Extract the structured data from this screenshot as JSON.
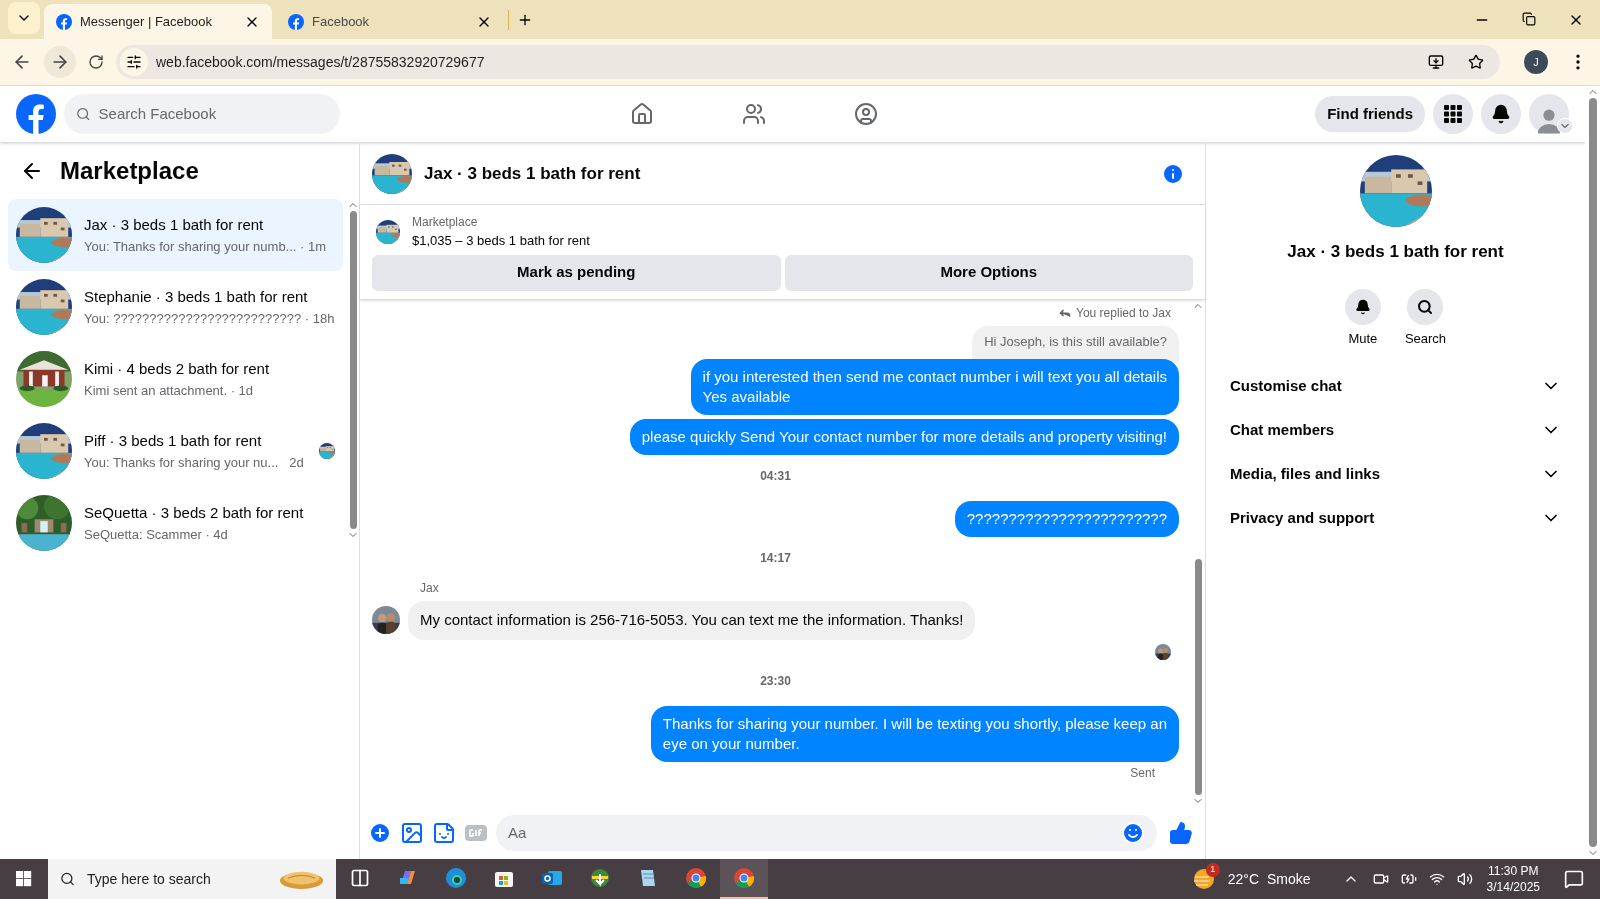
{
  "browser": {
    "tabs": [
      {
        "title": "Messenger | Facebook",
        "selected": true
      },
      {
        "title": "Facebook",
        "selected": false
      }
    ],
    "url": "web.facebook.com/messages/t/28755832920729677",
    "profile_initial": "J"
  },
  "header": {
    "search_placeholder": "Search Facebook",
    "find_friends": "Find friends"
  },
  "sidebar": {
    "title": "Marketplace",
    "conversations": [
      {
        "title": "Jax · 3 beds 1 bath for rent",
        "preview": "You: Thanks for sharing your numb... · 1m",
        "selected": true,
        "seen_avatar": false
      },
      {
        "title": "Stephanie · 3 beds 1 bath for rent",
        "preview": "You: ?????????????????????????? · 18h",
        "selected": false,
        "seen_avatar": false
      },
      {
        "title": "Kimi · 4 beds 2 bath for rent",
        "preview": "Kimi sent an attachment. · 1d",
        "selected": false,
        "seen_avatar": false
      },
      {
        "title": "Piff · 3 beds 1 bath for rent",
        "preview": "You: Thanks for sharing your nu...   2d",
        "selected": false,
        "seen_avatar": true
      },
      {
        "title": "SeQuetta · 3 beds 2 bath for rent",
        "preview": "SeQuetta: Scammer · 4d",
        "selected": false,
        "seen_avatar": false
      }
    ]
  },
  "chat": {
    "title": "Jax · 3 beds 1 bath for rent",
    "listing": {
      "label": "Marketplace",
      "price_title": "$1,035 – 3 beds 1 bath for rent"
    },
    "actions": [
      "Mark as pending",
      "More Options"
    ],
    "messages": [
      {
        "kind": "reply_note",
        "text": "You replied to Jax"
      },
      {
        "kind": "quoted",
        "text": "Hi Joseph, is this still available?"
      },
      {
        "kind": "outgoing",
        "text": "if you interested then send me contact number i will text you all details\nYes available"
      },
      {
        "kind": "outgoing",
        "text": "please quickly Send Your contact number for more details and property visiting!"
      },
      {
        "kind": "timestamp",
        "text": "04:31"
      },
      {
        "kind": "outgoing",
        "text": "????????????????????????"
      },
      {
        "kind": "timestamp",
        "text": "14:17"
      },
      {
        "kind": "sender",
        "text": "Jax"
      },
      {
        "kind": "incoming",
        "text": "My contact information is 256-716-5053. You can text me the information. Thanks!"
      },
      {
        "kind": "seen"
      },
      {
        "kind": "timestamp",
        "text": "23:30"
      },
      {
        "kind": "outgoing",
        "text": "Thanks for sharing your number. I will be texting you shortly, please keep an\neye on your number."
      },
      {
        "kind": "status",
        "text": "Sent"
      }
    ],
    "composer_placeholder": "Aa"
  },
  "details": {
    "title": "Jax · 3 beds 1 bath for rent",
    "actions": [
      {
        "kind": "mute",
        "label": "Mute"
      },
      {
        "kind": "search",
        "label": "Search"
      }
    ],
    "sections": [
      {
        "label": "Customise chat",
        "expanded": false
      },
      {
        "label": "Chat members",
        "expanded": false
      },
      {
        "label": "Media, files and links",
        "expanded": false
      },
      {
        "label": "Privacy and support",
        "expanded": false
      }
    ]
  },
  "taskbar": {
    "search_placeholder": "Type here to search",
    "apps": [
      {
        "kind": "taskview",
        "selected": false
      },
      {
        "kind": "copilot",
        "selected": false
      },
      {
        "kind": "edge",
        "selected": false
      },
      {
        "kind": "store",
        "selected": false
      },
      {
        "kind": "outlook",
        "selected": false
      },
      {
        "kind": "downloader",
        "selected": false
      },
      {
        "kind": "notepad",
        "selected": false
      },
      {
        "kind": "chrome",
        "selected": false
      },
      {
        "kind": "chrome",
        "selected": true
      }
    ],
    "weather_badge": "1",
    "temperature": "22°C",
    "weather": "Smoke",
    "time": "11:30 PM",
    "date": "3/14/2025"
  }
}
